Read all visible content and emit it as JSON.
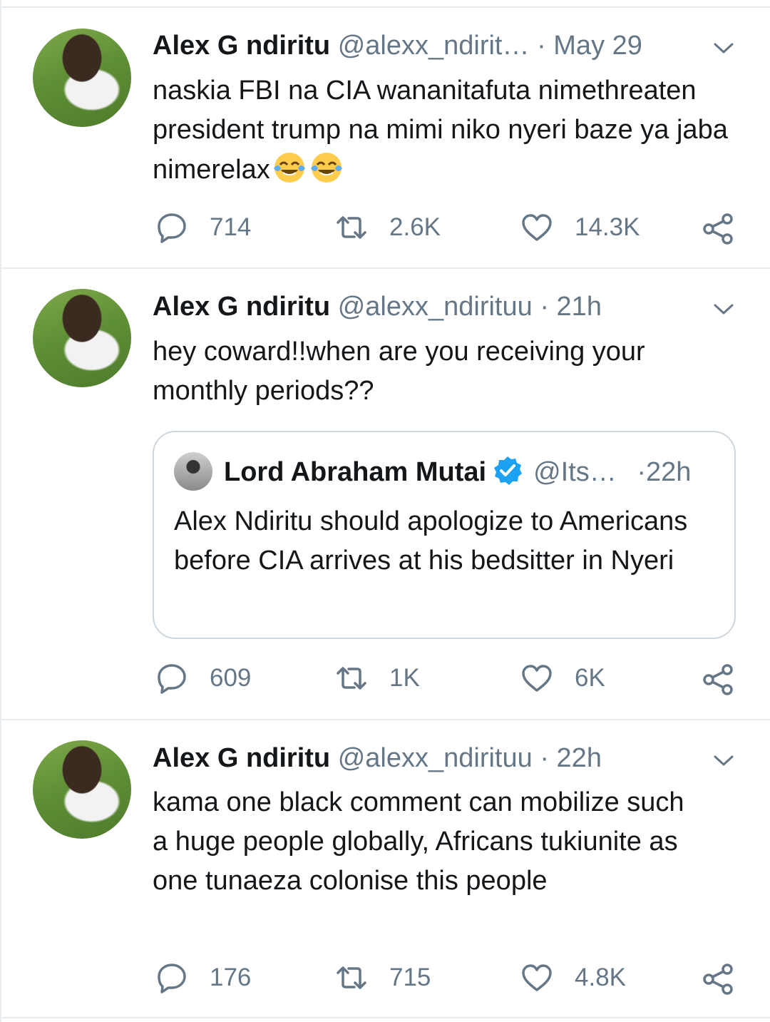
{
  "tweets": [
    {
      "name": "Alex G ndiritu",
      "handle": "@alexx_ndirit…",
      "time": "May 29",
      "text": "naskia FBI na CIA wananitafuta nimethreaten president trump na mimi niko nyeri baze ya jaba nimerelax",
      "emoji": "face-with-tears-of-joy-icon",
      "replies": "714",
      "retweets": "2.6K",
      "likes": "14.3K"
    },
    {
      "name": "Alex G ndiritu",
      "handle": "@alexx_ndirituu",
      "time": "21h",
      "text": "hey coward!!when are you receiving your monthly periods??",
      "replies": "609",
      "retweets": "1K",
      "likes": "6K",
      "quote": {
        "name": "Lord Abraham Mutai",
        "handle": "@Its…",
        "time": "22h",
        "text": "Alex Ndiritu should apologize to Americans before CIA arrives at his bedsitter in Nyeri"
      }
    },
    {
      "name": "Alex G ndiritu",
      "handle": "@alexx_ndirituu",
      "time": "22h",
      "text": "kama one black comment can mobilize such a huge people globally, Africans tukiunite as one tunaeza colonise this people",
      "replies": "176",
      "retweets": "715",
      "likes": "4.8K"
    }
  ],
  "separator_dot": "·",
  "colors": {
    "muted": "#657786",
    "text": "#14171a",
    "verified": "#1da1f2",
    "border": "#e6ecf0"
  }
}
